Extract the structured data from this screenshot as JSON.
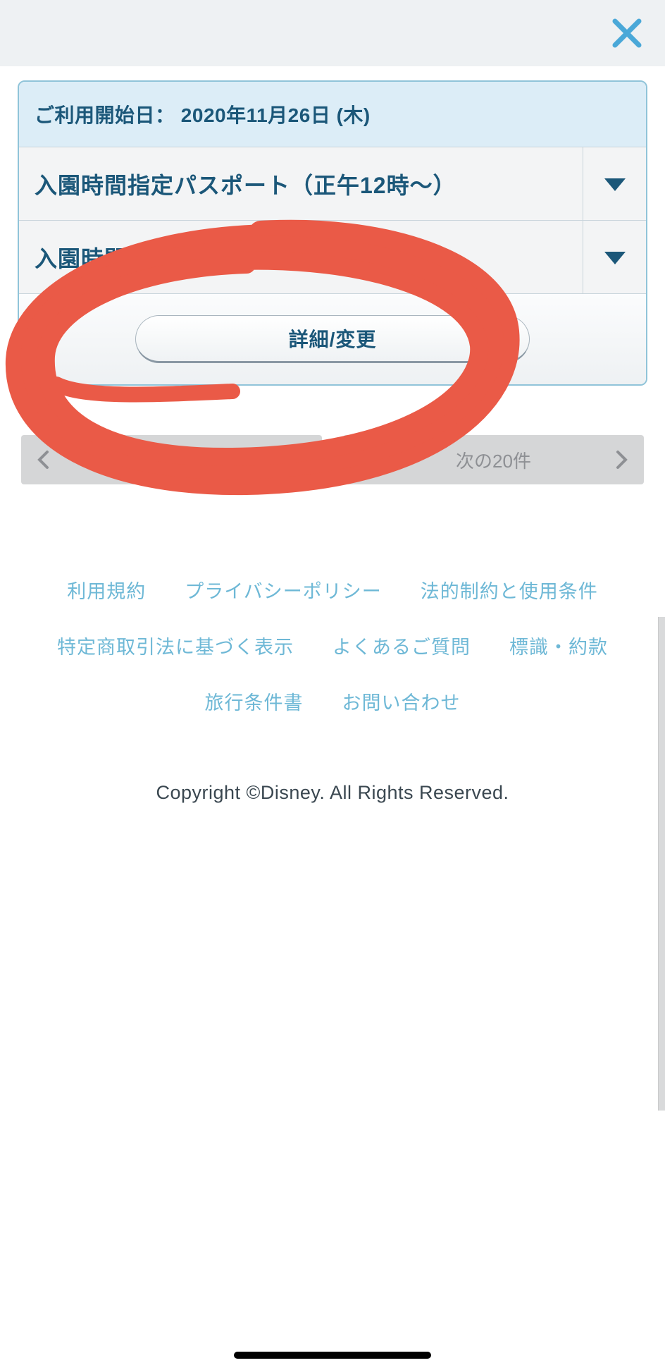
{
  "header": {
    "close_label": "閉じる"
  },
  "card": {
    "date_label_prefix": "ご利用開始日：",
    "date_value": "2020年11月26日 (木)",
    "options": [
      {
        "label": "入園時間指定パスポート（正午12時〜）"
      },
      {
        "label": "入園時間指定パスポート（正午12時〜）"
      }
    ],
    "detail_button": "詳細/変更"
  },
  "pagination": {
    "prev_label": "前の20件",
    "next_label": "次の20件"
  },
  "footer": {
    "links": [
      "利用規約",
      "プライバシーポリシー",
      "法的制約と使用条件",
      "特定商取引法に基づく表示",
      "よくあるご質問",
      "標識・約款",
      "旅行条件書",
      "お問い合わせ"
    ],
    "copyright": "Copyright ©Disney. All Rights Reserved."
  },
  "colors": {
    "accent": "#4aa8d8",
    "text_primary": "#1b5779",
    "annotation": "#ea5a47"
  }
}
